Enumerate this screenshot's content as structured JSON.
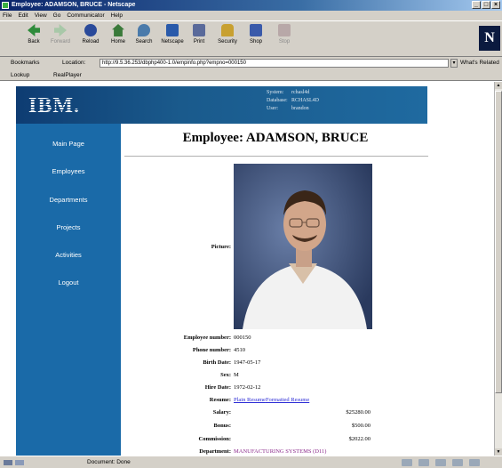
{
  "window": {
    "title": "Employee: ADAMSON, BRUCE - Netscape",
    "controls": [
      "_",
      "□",
      "×"
    ]
  },
  "menu": [
    "File",
    "Edit",
    "View",
    "Go",
    "Communicator",
    "Help"
  ],
  "toolbar": {
    "buttons": [
      {
        "label": "Back",
        "icon": "back-arrow-icon"
      },
      {
        "label": "Forward",
        "icon": "forward-arrow-icon"
      },
      {
        "label": "Reload",
        "icon": "reload-icon"
      },
      {
        "label": "Home",
        "icon": "home-icon"
      },
      {
        "label": "Search",
        "icon": "search-icon"
      },
      {
        "label": "Netscape",
        "icon": "netscape-icon"
      },
      {
        "label": "Print",
        "icon": "print-icon"
      },
      {
        "label": "Security",
        "icon": "security-lock-icon"
      },
      {
        "label": "Shop",
        "icon": "shop-bag-icon"
      },
      {
        "label": "Stop",
        "icon": "stop-icon"
      }
    ],
    "logo_letter": "N"
  },
  "location": {
    "bookmarks_label": "Bookmarks",
    "location_label": "Location:",
    "url": "http://9.5.36.253/dbphp400-1.0/empinfo.php?empno=000150",
    "related_label": "What's Related"
  },
  "personal": {
    "lookup": "Lookup",
    "realplayer": "RealPlayer"
  },
  "banner": {
    "logo": "IBM.",
    "system_label": "System:",
    "system_value": "rchasl4d",
    "database_label": "Database:",
    "database_value": "RCHASL4D",
    "user_label": "User:",
    "user_value": "brandon"
  },
  "nav": [
    "Main Page",
    "Employees",
    "Departments",
    "Projects",
    "Activities",
    "Logout"
  ],
  "employee": {
    "title": "Employee: ADAMSON, BRUCE",
    "picture_label": "Picture:",
    "fields": {
      "empno_label": "Employee number:",
      "empno": "000150",
      "phone_label": "Phone number:",
      "phone": "4510",
      "birth_label": "Birth Date:",
      "birth": "1947-05-17",
      "sex_label": "Sex:",
      "sex": "M",
      "hire_label": "Hire Date:",
      "hire": "1972-02-12",
      "resume_label": "Resume:",
      "resume_plain": "Plain Resume",
      "resume_formatted": "Formatted Resume",
      "salary_label": "Salary:",
      "salary": "$25280.00",
      "bonus_label": "Bonus:",
      "bonus": "$500.00",
      "commission_label": "Commission:",
      "commission": "$2022.00",
      "department_label": "Department:",
      "department": "MANUFACTURING SYSTEMS (D11)"
    }
  },
  "status": {
    "text": "Document: Done"
  }
}
